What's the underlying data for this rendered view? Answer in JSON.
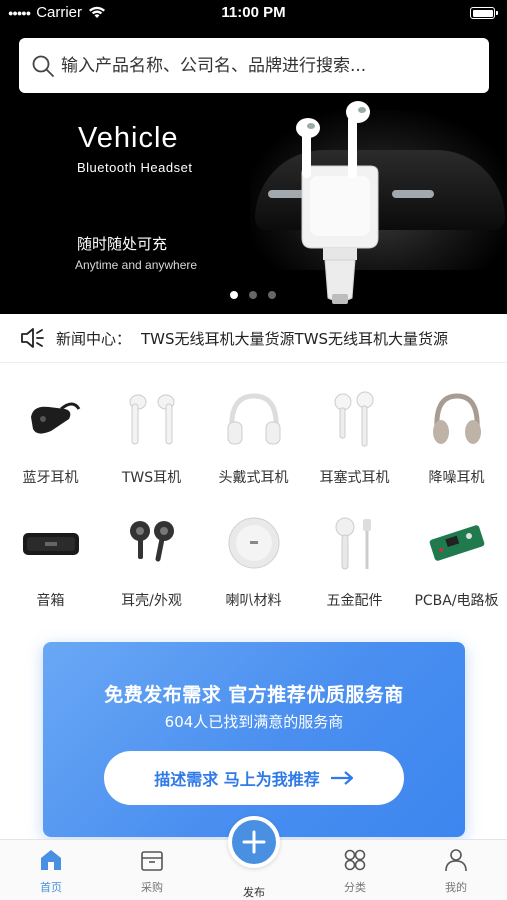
{
  "status_bar": {
    "carrier": "Carrier",
    "time": "11:00 PM"
  },
  "search": {
    "placeholder": "输入产品名称、公司名、品牌进行搜索..."
  },
  "banner": {
    "title": "Vehicle",
    "subtitle": "Bluetooth Headset",
    "slogan_cn": "随时随处可充",
    "slogan_en": "Anytime and anywhere",
    "page_count": 3,
    "active_page": 1
  },
  "news": {
    "label": "新闻中心：",
    "text": "TWS无线耳机大量货源TWS无线耳机大量货源"
  },
  "categories": [
    {
      "label": "蓝牙耳机",
      "icon": "bluetooth-earpiece-icon"
    },
    {
      "label": "TWS耳机",
      "icon": "tws-earbuds-icon"
    },
    {
      "label": "头戴式耳机",
      "icon": "over-ear-headphones-icon"
    },
    {
      "label": "耳塞式耳机",
      "icon": "earbud-headphones-icon"
    },
    {
      "label": "降噪耳机",
      "icon": "noise-cancelling-headphones-icon"
    },
    {
      "label": "音箱",
      "icon": "speaker-icon"
    },
    {
      "label": "耳壳/外观",
      "icon": "earphone-shell-icon"
    },
    {
      "label": "喇叭材料",
      "icon": "speaker-driver-icon"
    },
    {
      "label": "五金配件",
      "icon": "hardware-accessory-icon"
    },
    {
      "label": "PCBA/电路板",
      "icon": "circuit-board-icon"
    }
  ],
  "promo": {
    "title": "免费发布需求 官方推荐优质服务商",
    "subtitle": "604人已找到满意的服务商",
    "button": "描述需求 马上为我推荐"
  },
  "tabbar": {
    "home": "首页",
    "purchase": "采购",
    "publish": "发布",
    "category": "分类",
    "mine": "我的"
  },
  "colors": {
    "accent": "#4a90e2",
    "promo_start": "#6aa8f5",
    "promo_end": "#3c86ef"
  }
}
